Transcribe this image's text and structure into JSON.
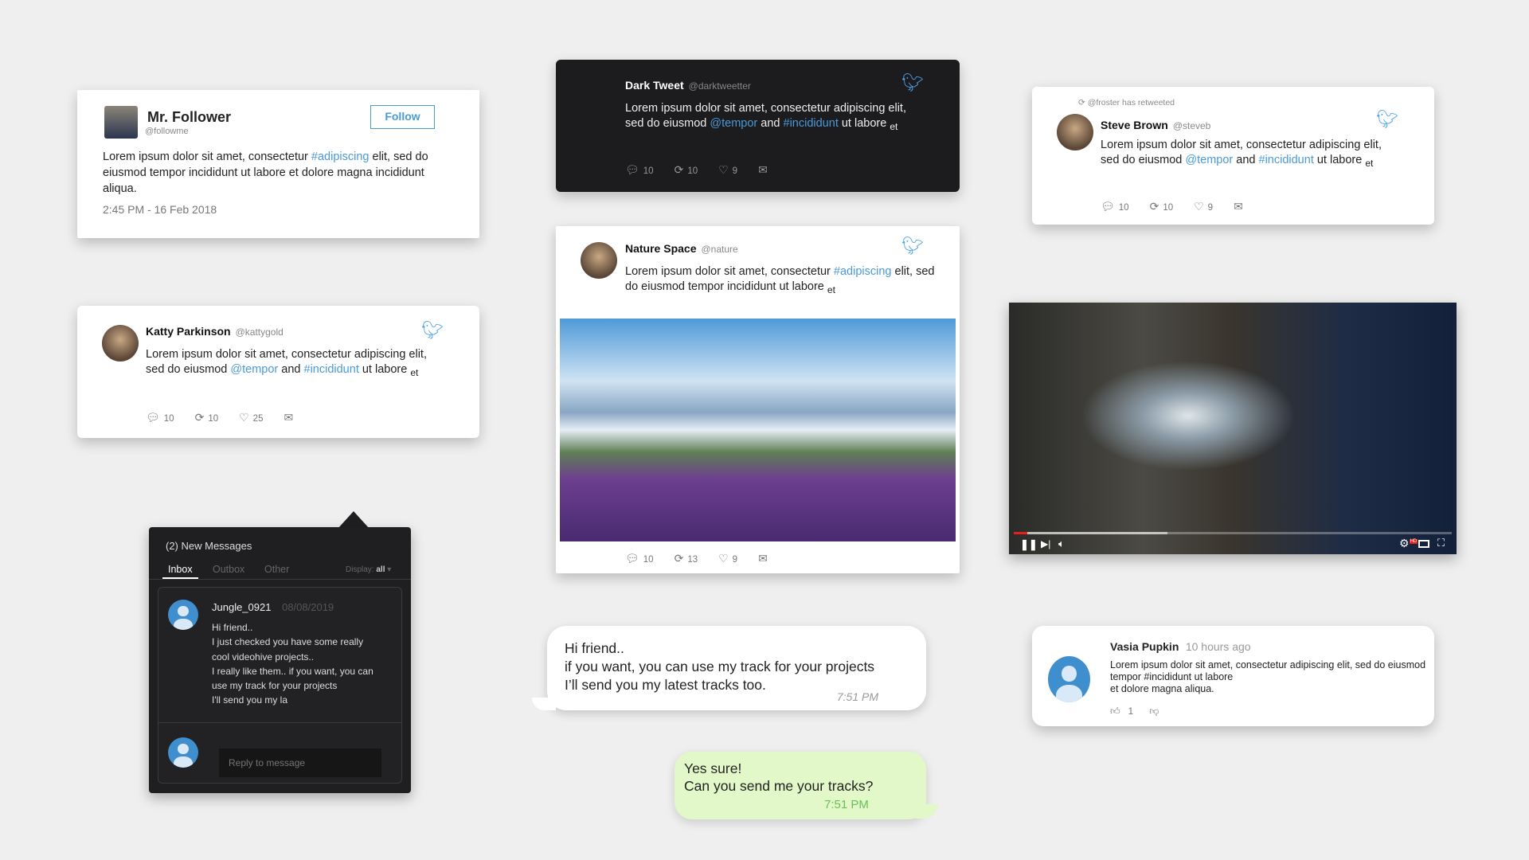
{
  "follower_card": {
    "name": "Mr. Follower",
    "handle": "@followme",
    "follow_label": "Follow",
    "text_a": "Lorem ipsum dolor sit amet, consectetur ",
    "text_tag": "#adipiscing",
    "text_b": " elit, sed do eiusmod tempor incididunt ut labore et dolore magna incididunt aliqua.",
    "timestamp": "2:45 PM - 16 Feb 2018"
  },
  "katty": {
    "name": "Katty Parkinson",
    "handle": "@kattygold",
    "text_a": "Lorem ipsum dolor sit amet, consectetur adipiscing elit, sed do eiusmod ",
    "mention": "@tempor",
    "and": " and ",
    "tag": "#incididunt",
    "text_b": " ut labore",
    "trail": "et",
    "replies": "10",
    "retweets": "10",
    "likes": "25"
  },
  "dark": {
    "name": "Dark Tweet",
    "handle": "@darktweetter",
    "text_a": "Lorem ipsum dolor sit amet, consectetur adipiscing elit, sed do eiusmod ",
    "mention": "@tempor",
    "and": " and ",
    "tag": "#incididunt",
    "text_b": " ut labore",
    "trail": "et",
    "replies": "10",
    "retweets": "10",
    "likes": "9"
  },
  "nature": {
    "name": "Nature Space",
    "handle": "@nature",
    "text_a": "Lorem ipsum dolor sit amet, consectetur ",
    "tag": "#adipiscing",
    "text_b": " elit, sed do eiusmod tempor incididunt ut labore",
    "trail": "et",
    "replies": "10",
    "retweets": "13",
    "likes": "9"
  },
  "steve": {
    "retweeted_by": "@froster has retweeted",
    "name": "Steve Brown",
    "handle": "@steveb",
    "text_a": "Lorem ipsum dolor sit amet, consectetur adipiscing elit, sed do eiusmod ",
    "mention": "@tempor",
    "and": " and ",
    "tag": "#incididunt",
    "text_b": " ut labore",
    "trail": "et",
    "replies": "10",
    "retweets": "10",
    "likes": "9"
  },
  "video": {
    "progress_percent": 3,
    "buffered_percent": 35,
    "hd_badge": "HD",
    "accent": "#e62117"
  },
  "vasia": {
    "name": "Vasia Pupkin",
    "time": "10 hours ago",
    "text": "Lorem ipsum dolor sit amet, consectetur adipiscing elit, sed do eiusmod tempor #incididunt ut labore",
    "text2": "et dolore magna aliqua.",
    "likes": "1"
  },
  "messages": {
    "title": "(2) New Messages",
    "tabs": [
      "Inbox",
      "Outbox",
      "Other"
    ],
    "display_label": "Display:",
    "display_value": "all",
    "sender": "Jungle_0921",
    "date": "08/08/2019",
    "lines": [
      "Hi friend..",
      "I just checked you have some really",
      "cool videohive projects..",
      "I really like them.. if you want, you can",
      "use my track for your projects",
      "I'll send you my la"
    ],
    "reply_placeholder": "Reply to message"
  },
  "chat": {
    "incoming": [
      "Hi friend..",
      "if you want, you can use my track for your projects",
      "I’ll send you my latest tracks too."
    ],
    "incoming_time": "7:51 PM",
    "outgoing": [
      "Yes sure!",
      "Can you send me your tracks?"
    ],
    "outgoing_time": "7:51 PM"
  },
  "colors": {
    "link": "#4a9ad8",
    "twitter": "#4da3e8",
    "dark_bg": "#1c1c1e",
    "bubble_green": "#e2f8c8"
  }
}
